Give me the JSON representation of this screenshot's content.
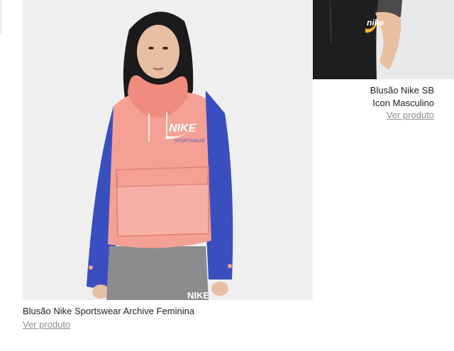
{
  "products": [
    {
      "title": "Blusão Nike Sportswear Archive Feminina",
      "link_label": "Ver produto",
      "jacket_brand": "NIKE",
      "jacket_subbrand": "SPORTSWEAR",
      "pants_brand": "NIKE"
    },
    {
      "title_line1": "Blusão Nike SB",
      "title_line2": "Icon Masculino",
      "link_label": "Ver produto",
      "logo_text": "nike"
    }
  ],
  "colors": {
    "jacket_pink": "#f4a094",
    "sleeve_blue": "#3a4fbf",
    "pants_grey": "#8c8c8e",
    "side_jacket": "#1e1e1e",
    "accent_yellow": "#f2b22c"
  }
}
